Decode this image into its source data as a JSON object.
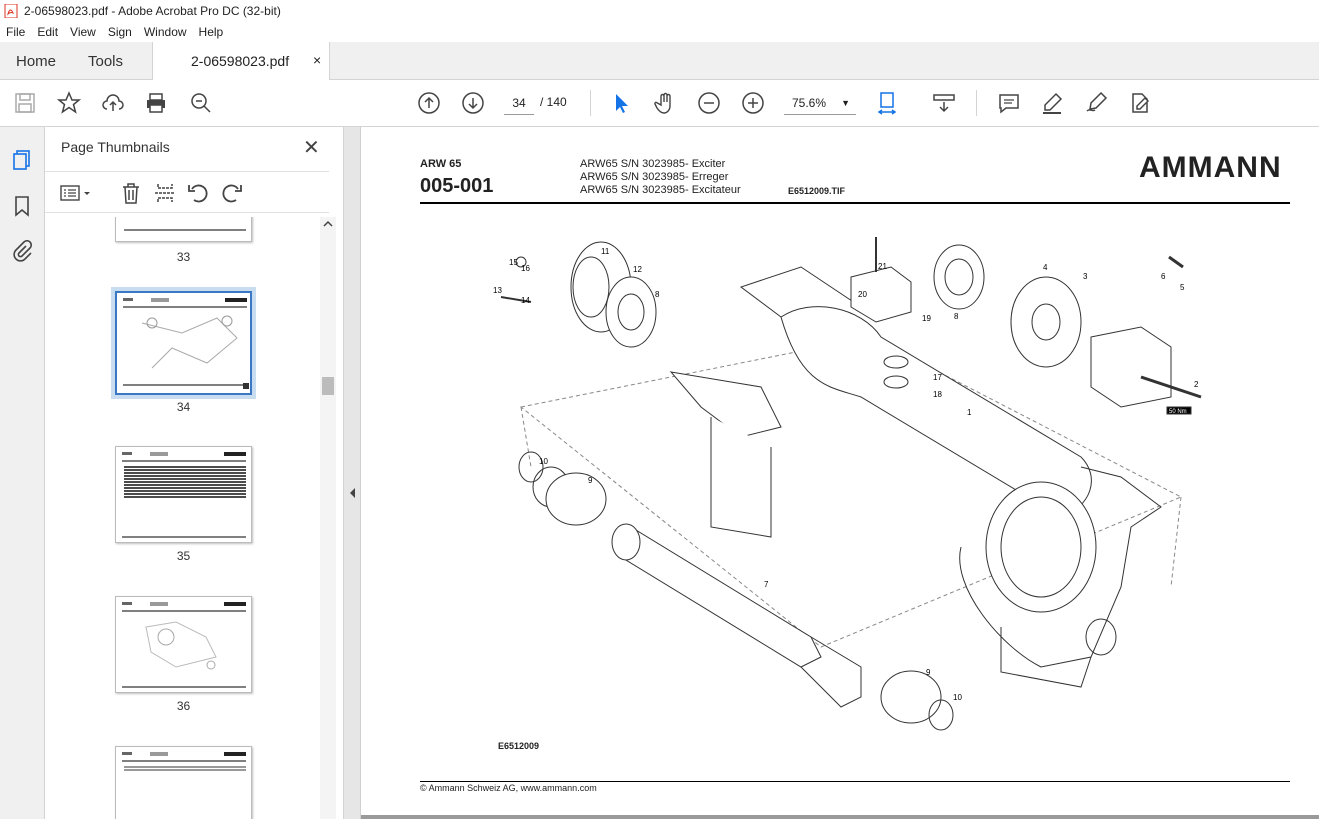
{
  "window": {
    "title": "2-06598023.pdf - Adobe Acrobat Pro DC (32-bit)"
  },
  "menu": [
    "File",
    "Edit",
    "View",
    "Sign",
    "Window",
    "Help"
  ],
  "tabs": {
    "home": "Home",
    "tools": "Tools",
    "doc": "2-06598023.pdf",
    "close": "×"
  },
  "toolbar": {
    "page_current": "34",
    "page_total": "/ 140",
    "zoom": "75.6%"
  },
  "panel": {
    "title": "Page Thumbnails",
    "close": "✕",
    "thumbs": [
      {
        "num": "33",
        "selected": false
      },
      {
        "num": "34",
        "selected": true
      },
      {
        "num": "35",
        "selected": false
      },
      {
        "num": "36",
        "selected": false
      }
    ]
  },
  "page": {
    "model": "ARW 65",
    "code": "005-001",
    "desc": [
      "ARW65 S/N 3023985- Exciter",
      "ARW65 S/N 3023985- Erreger",
      "ARW65 S/N 3023985- Excitateur"
    ],
    "file": "E6512009.TIF",
    "logo": "AMMANN",
    "drawing_id": "E6512009",
    "footer": "© Ammann Schweiz AG, www.ammann.com",
    "callouts": [
      "15",
      "16",
      "13",
      "14",
      "11",
      "12",
      "8",
      "21",
      "20",
      "19",
      "17",
      "18",
      "1",
      "8",
      "4",
      "3",
      "6",
      "5",
      "2",
      "50 Nm",
      "10",
      "9",
      "7",
      "9",
      "10"
    ]
  }
}
